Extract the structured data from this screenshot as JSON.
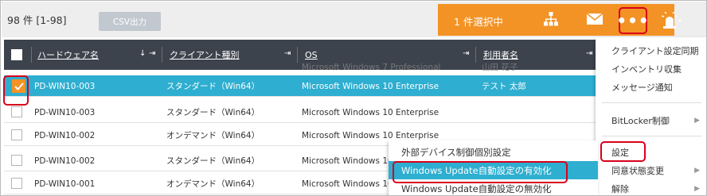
{
  "toolbar": {
    "count_text": "98 件  [1-98]",
    "csv_label": "CSV出力",
    "selection_text": "1 件選択中",
    "icons": [
      "org-tree-icon",
      "mail-icon",
      "more-dots-icon",
      "alarm-icon"
    ],
    "more_label": "•••",
    "accent_color": "#f39325"
  },
  "table": {
    "columns": [
      {
        "label": "ハードウェア名",
        "sort": "↓"
      },
      {
        "label": "クライアント種別"
      },
      {
        "label": "OS"
      },
      {
        "label": "利用者名"
      }
    ],
    "partial_row": {
      "hostname": "",
      "os": "Microsoft Windows 7 Professional",
      "user": "山田 花子"
    },
    "rows": [
      {
        "hostname": "PD-WIN10-003",
        "client_type": "スタンダード（Win64）",
        "os": "Microsoft Windows 10 Enterprise",
        "user": "テスト 太郎",
        "selected": true
      },
      {
        "hostname": "PD-WIN10-003",
        "client_type": "スタンダード（Win64）",
        "os": "Microsoft Windows 10 Enterprise",
        "user": "",
        "selected": false
      },
      {
        "hostname": "PD-WIN10-002",
        "client_type": "オンデマンド（Win64）",
        "os": "Microsoft Windows 10 Enterprise",
        "user": "",
        "selected": false
      },
      {
        "hostname": "PD-WIN10-002",
        "client_type": "スタンダード（Win64）",
        "os": "Microsoft Windows 10 Enterprise",
        "user": "",
        "selected": false
      },
      {
        "hostname": "PD-WIN10-001",
        "client_type": "オンデマンド（Win64）",
        "os": "Microsoft Windows 10 Enterprise",
        "user": "",
        "selected": false
      }
    ],
    "selected_color": "#2eaed0"
  },
  "menu": {
    "items": [
      {
        "label": "クライアント設定同期"
      },
      {
        "label": "インベントリ収集"
      },
      {
        "label": "メッセージ通知"
      },
      {
        "label": "BitLocker制御",
        "submenu": true
      },
      {
        "label": "設定"
      },
      {
        "label": "同意状態変更",
        "submenu": true
      },
      {
        "label": "解除",
        "submenu": true
      }
    ]
  },
  "submenu": {
    "items": [
      {
        "label": "外部デバイス制御個別設定"
      },
      {
        "label": "Windows Update自動設定の有効化",
        "active": true
      },
      {
        "label": "Windows Update自動設定の無効化"
      }
    ]
  }
}
